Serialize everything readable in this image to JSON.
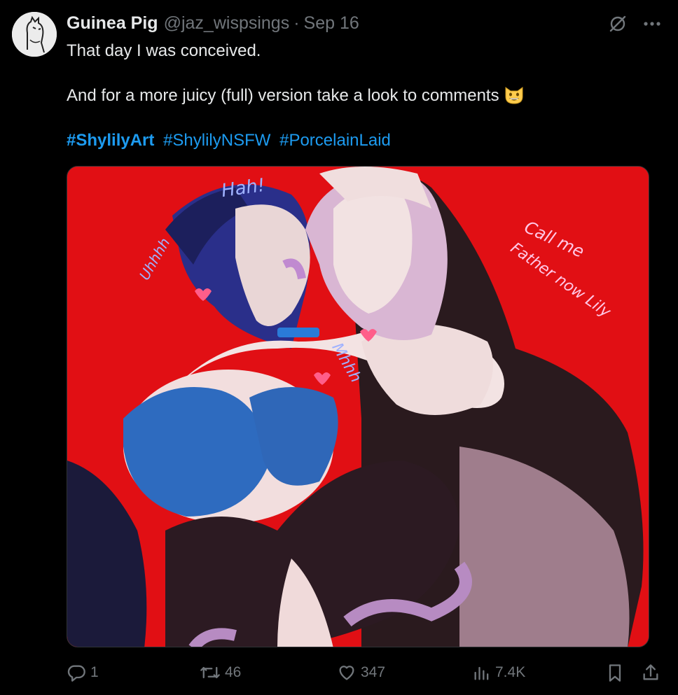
{
  "user": {
    "display_name": "Guinea Pig",
    "handle": "@jaz_wispsings",
    "separator": "·",
    "date": "Sep 16",
    "avatar_icon": "avatar-sketch-icon"
  },
  "header_icons": {
    "grok": "grok-icon",
    "more": "more-icon"
  },
  "tweet": {
    "line1": "That day I was conceived.",
    "line2": "And for a more juicy (full) version take a look to comments",
    "emoji": "grinning-cat-emoji",
    "hashtags": [
      "#ShylilyArt",
      "#ShylilyNSFW",
      "#PorcelainLaid"
    ]
  },
  "media": {
    "alt_icon": "illustration",
    "annotations": {
      "hah": "Hah!",
      "uhhh": "Uhhhh",
      "call_me": "Call me",
      "father": "Father now Lily",
      "mhhh": "Mhhh"
    }
  },
  "actions": {
    "reply_count": "1",
    "repost_count": "46",
    "like_count": "347",
    "views_count": "7.4K"
  },
  "colors": {
    "background": "#000000",
    "text": "#e7e9ea",
    "muted": "#71767b",
    "link": "#1d9bf0",
    "media_bg": "#e10f14"
  }
}
